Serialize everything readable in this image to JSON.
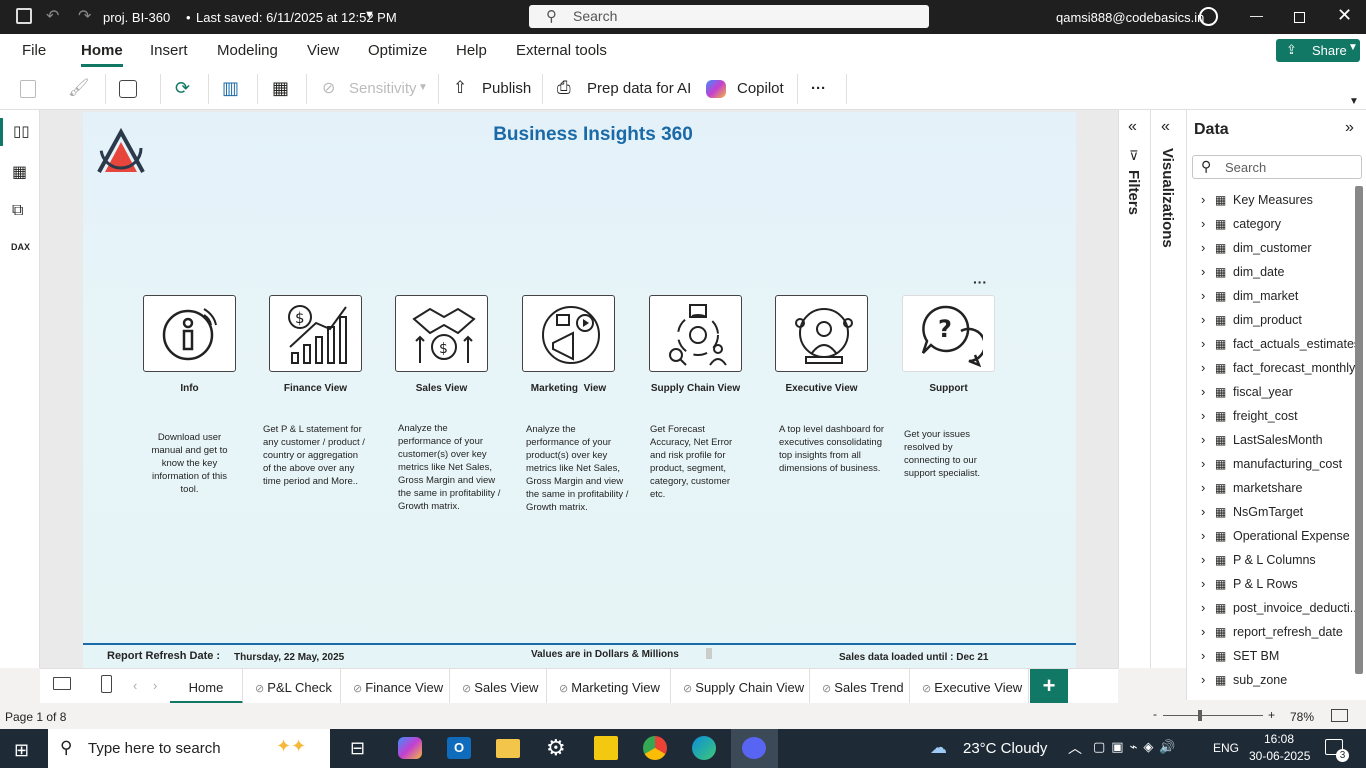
{
  "titlebar": {
    "file_title": "proj. BI-360",
    "save_status": "Last saved: 6/11/2025 at 12:52 PM",
    "search_placeholder": "Search",
    "user": "qamsi888@codebasics.in"
  },
  "ribbon": {
    "tabs": [
      "File",
      "Home",
      "Insert",
      "Modeling",
      "View",
      "Optimize",
      "Help",
      "External tools"
    ],
    "active_tab": "Home",
    "share_label": "Share"
  },
  "toolbar": {
    "sensitivity": "Sensitivity",
    "publish": "Publish",
    "prep_data": "Prep data for AI",
    "copilot": "Copilot",
    "more": "···"
  },
  "report": {
    "title": "Business Insights 360",
    "cards": [
      {
        "label": "Info",
        "desc": "Download user manual and get to know the key information of this tool."
      },
      {
        "label": "Finance View",
        "desc": "Get P & L statement for any customer / product / country or aggregation of the above over any time period and More.."
      },
      {
        "label": "Sales View",
        "desc": "Analyze the performance of your customer(s) over key metrics like Net Sales, Gross Margin and view the same in profitability / Growth matrix."
      },
      {
        "label": "Marketing  View",
        "desc": "Analyze the performance of your product(s) over key metrics like Net Sales, Gross Margin and view the same in profitability / Growth matrix."
      },
      {
        "label": "Supply Chain View",
        "desc": "Get Forecast Accuracy, Net Error and risk profile for product, segment, category, customer etc."
      },
      {
        "label": "Executive View",
        "desc": "A top level dashboard for executives consolidating top insights from all dimensions of business."
      },
      {
        "label": "Support",
        "desc": "Get your issues resolved by connecting to our support specialist."
      }
    ],
    "footer": {
      "refresh_label": "Report Refresh Date :",
      "refresh_date": "Thursday, 22 May, 2025",
      "values_note": "Values are in Dollars & Millions",
      "sales_loaded": "Sales data loaded until : Dec 21"
    }
  },
  "panes": {
    "filters": "Filters",
    "visualizations": "Visualizations",
    "data_title": "Data",
    "data_search_placeholder": "Search",
    "fields": [
      "Key Measures",
      "category",
      "dim_customer",
      "dim_date",
      "dim_market",
      "dim_product",
      "fact_actuals_estimates",
      "fact_forecast_monthly",
      "fiscal_year",
      "freight_cost",
      "LastSalesMonth",
      "manufacturing_cost",
      "marketshare",
      "NsGmTarget",
      "Operational Expense",
      "P & L Columns",
      "P & L Rows",
      "post_invoice_deducti...",
      "report_refresh_date",
      "SET BM",
      "sub_zone"
    ]
  },
  "page_tabs": [
    "Home",
    "P&L Check",
    "Finance View",
    "Sales View",
    "Marketing View",
    "Supply Chain View",
    "Sales Trend",
    "Executive View"
  ],
  "status": {
    "page_info": "Page 1 of 8",
    "zoom": "78%"
  },
  "taskbar": {
    "search_placeholder": "Type here to search",
    "weather": "23°C  Cloudy",
    "language": "ENG",
    "time": "16:08",
    "date": "30-06-2025",
    "notifications": "3"
  },
  "colors": {
    "accent": "#117865",
    "title_blue": "#1b6aa8",
    "logo_red": "#e8453c"
  }
}
